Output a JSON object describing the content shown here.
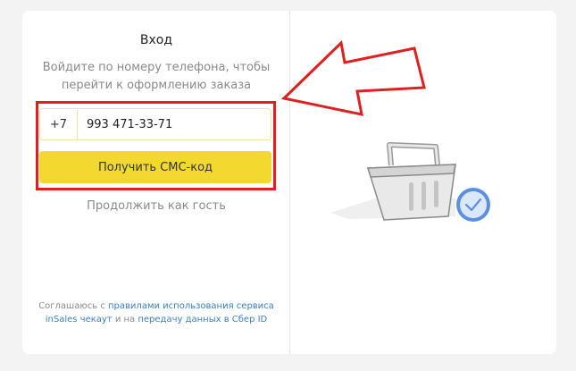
{
  "login": {
    "title": "Вход",
    "subtitle": "Войдите по номеру телефона, чтобы перейти к оформлению заказа",
    "phone_prefix": "+7",
    "phone_value": "993 471-33-71",
    "sms_button": "Получить СМС-код",
    "guest_link": "Продолжить как гость"
  },
  "consent": {
    "part1": "Соглашаюсь с ",
    "link1": "правилами использования сервиса inSales чекаут",
    "part2": " и на ",
    "link2": "передачу данных в Сбер ID"
  },
  "colors": {
    "accent": "#f3d92f",
    "highlight": "#e02020",
    "link": "#3c7fc4"
  },
  "icons": {
    "arrow": "red-arrow-icon",
    "basket": "shopping-basket-icon",
    "check": "check-badge-icon"
  }
}
